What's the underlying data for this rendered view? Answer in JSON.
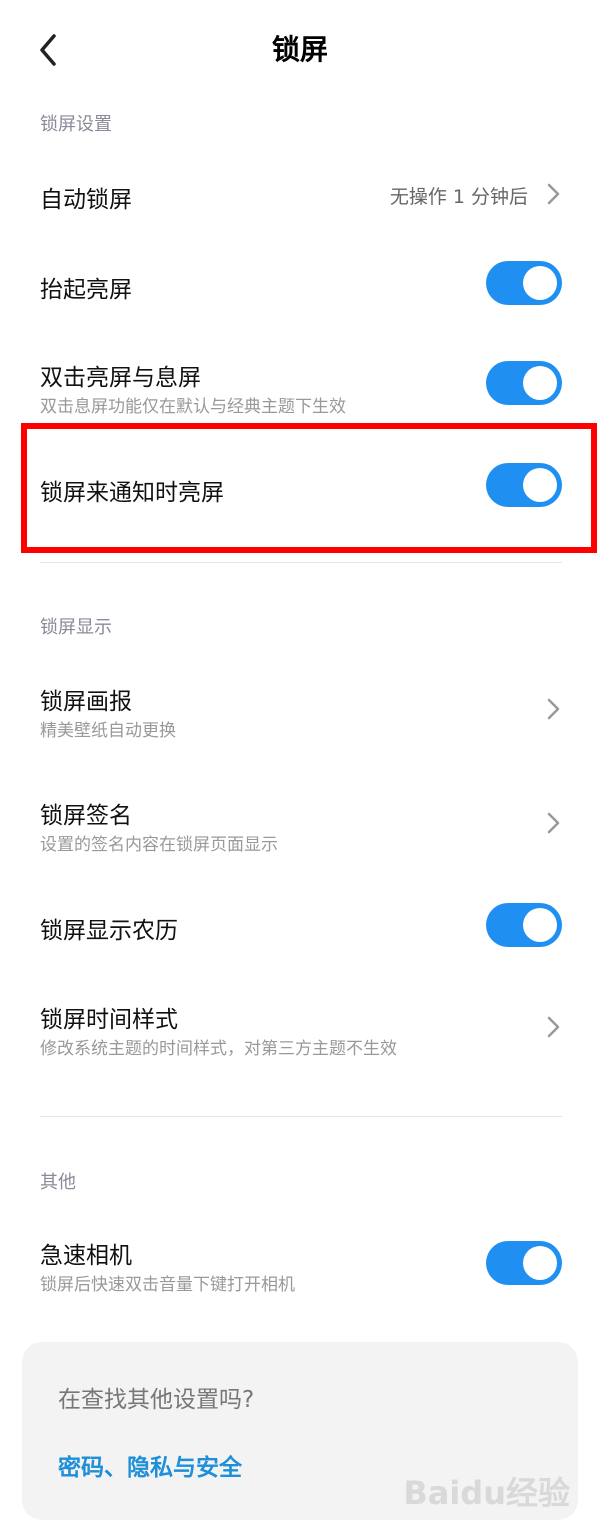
{
  "header": {
    "title": "锁屏"
  },
  "sections": {
    "lock_settings": "锁屏设置",
    "lock_display": "锁屏显示",
    "other": "其他"
  },
  "items": {
    "auto_lock": {
      "title": "自动锁屏",
      "value": "无操作 1 分钟后"
    },
    "raise_wake": {
      "title": "抬起亮屏",
      "on": true
    },
    "double_tap": {
      "title": "双击亮屏与息屏",
      "subtitle": "双击息屏功能仅在默认与经典主题下生效",
      "on": true
    },
    "notify_wake": {
      "title": "锁屏来通知时亮屏",
      "on": true
    },
    "lock_pictorial": {
      "title": "锁屏画报",
      "subtitle": "精美壁纸自动更换"
    },
    "lock_signature": {
      "title": "锁屏签名",
      "subtitle": "设置的签名内容在锁屏页面显示"
    },
    "lunar": {
      "title": "锁屏显示农历",
      "on": true
    },
    "time_style": {
      "title": "锁屏时间样式",
      "subtitle": "修改系统主题的时间样式，对第三方主题不生效"
    },
    "quick_camera": {
      "title": "急速相机",
      "subtitle": "锁屏后快速双击音量下键打开相机",
      "on": true
    }
  },
  "card": {
    "question": "在查找其他设置吗?",
    "link": "密码、隐私与安全"
  },
  "watermark": "Baidu经验",
  "colors": {
    "accent": "#1f8ff2",
    "highlight": "#ff0000",
    "link": "#1e8fd8"
  }
}
